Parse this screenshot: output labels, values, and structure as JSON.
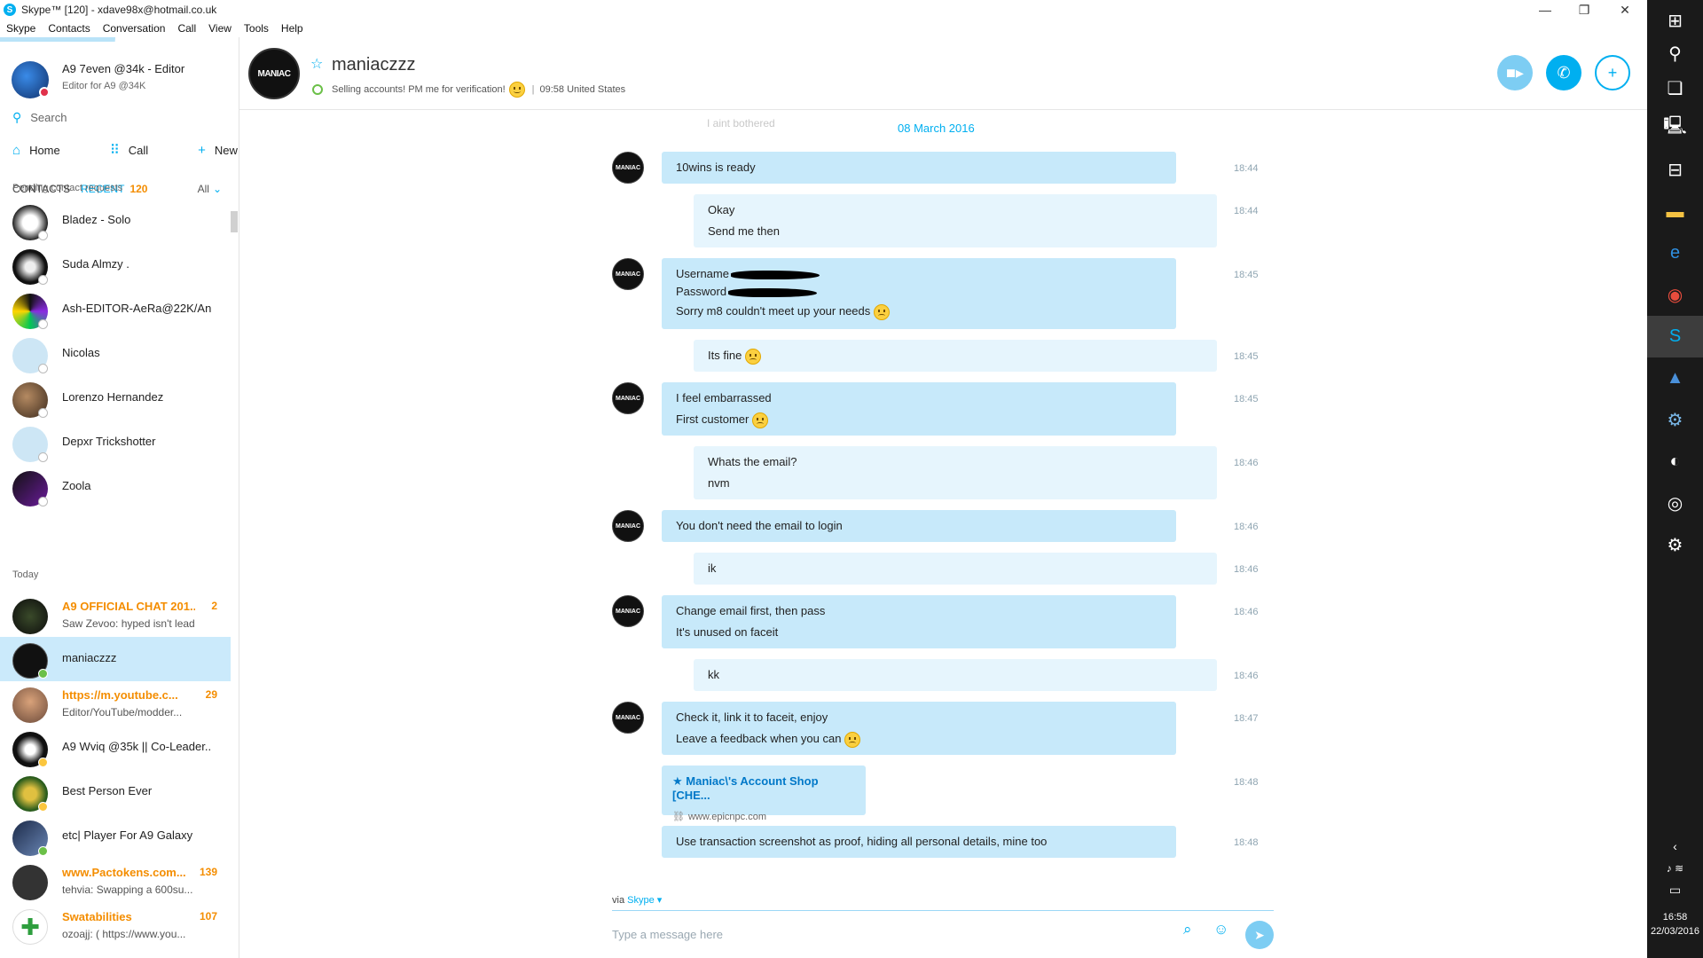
{
  "window": {
    "title": "Skype™ [120] - xdave98x@hotmail.co.uk",
    "logo_letter": "S",
    "controls": {
      "minimize": "—",
      "maximize": "❐",
      "close": "✕"
    }
  },
  "menu": [
    "Skype",
    "Contacts",
    "Conversation",
    "Call",
    "View",
    "Tools",
    "Help"
  ],
  "profile": {
    "name": "A9 7even @34k - Editor",
    "mood": "Editor for A9 @34K"
  },
  "search": {
    "placeholder": "Search"
  },
  "nav": {
    "home": "Home",
    "call": "Call",
    "new": "New"
  },
  "tabs": {
    "contacts": "CONTACTS",
    "recent": "RECENT",
    "recent_count": "120",
    "filter": "All"
  },
  "sections": {
    "pending": "Pending contact requests",
    "today": "Today"
  },
  "pending_contacts": [
    {
      "name": "Bladez - Solo"
    },
    {
      "name": "Suda Almzy ."
    },
    {
      "name": "Ash-EDITOR-AeRa@22K/An..."
    },
    {
      "name": "Nicolas"
    },
    {
      "name": "Lorenzo Hernandez"
    },
    {
      "name": "Depxr Trickshotter"
    },
    {
      "name": "Zoola"
    }
  ],
  "recent_contacts": [
    {
      "name": "A9 OFFICIAL CHAT 201...",
      "sub": "Saw Zevoo: hyped isn't lead...",
      "count": "2"
    },
    {
      "name": "maniaczzz",
      "sub": "",
      "count": ""
    },
    {
      "name": "https://m.youtube.c...",
      "sub": "Editor/YouTube/modder...",
      "count": "29"
    },
    {
      "name": "A9 Wviq @35k || Co-Leader...",
      "sub": "",
      "count": ""
    },
    {
      "name": "Best Person Ever",
      "sub": "",
      "count": ""
    },
    {
      "name": "etc| Player For A9 Galaxy",
      "sub": "",
      "count": ""
    },
    {
      "name": "www.Pactokens.com...",
      "sub": "tehvia: Swapping a 600su...",
      "count": "139"
    },
    {
      "name": "Swatabilities",
      "sub": "ozoajj: ( https://www.you...",
      "count": "107"
    }
  ],
  "header": {
    "name": "maniaczzz",
    "avatar_text": "MANIAC",
    "status": "Selling accounts! PM me for verification!",
    "separator": "|",
    "local_time": "09:58 United States",
    "icons": {
      "video": "video-call-icon",
      "call": "phone-icon",
      "add": "add-contact-icon"
    }
  },
  "conversation": {
    "ghost_text": "I aint bothered",
    "date": "08 March 2016",
    "messages": [
      {
        "lines": [
          "10wins is ready"
        ],
        "time": "18:44"
      },
      {
        "lines": [
          "Okay",
          "Send me then"
        ],
        "time": "18:44"
      },
      {
        "lines": [
          "Username",
          "Password",
          "Sorry m8 couldn't meet up your needs"
        ],
        "time": "18:45"
      },
      {
        "lines": [
          "Its fine"
        ],
        "time": "18:45"
      },
      {
        "lines": [
          "I feel embarrassed",
          "First customer"
        ],
        "time": "18:45"
      },
      {
        "lines": [
          "Whats the email?",
          "nvm"
        ],
        "time": "18:46"
      },
      {
        "lines": [
          "You don't need the email to login"
        ],
        "time": "18:46"
      },
      {
        "lines": [
          "ik"
        ],
        "time": "18:46"
      },
      {
        "lines": [
          "Change email first, then pass",
          "It's unused on faceit"
        ],
        "time": "18:46"
      },
      {
        "lines": [
          "kk"
        ],
        "time": "18:46"
      },
      {
        "lines": [
          "Check it, link it to faceit, enjoy",
          "Leave a feedback when you can"
        ],
        "time": "18:47"
      },
      {
        "link_title": "★ Maniac\\'s Account Shop [CHE...",
        "link_url": "www.epicnpc.com",
        "time": "18:48"
      },
      {
        "lines": [
          "Use transaction screenshot as proof, hiding all personal details, mine too"
        ],
        "time": "18:48"
      }
    ]
  },
  "composer": {
    "via_label": "via",
    "via_service": "Skype",
    "placeholder": "Type a message here"
  },
  "taskbar": {
    "time": "16:58",
    "date": "22/03/2016"
  }
}
